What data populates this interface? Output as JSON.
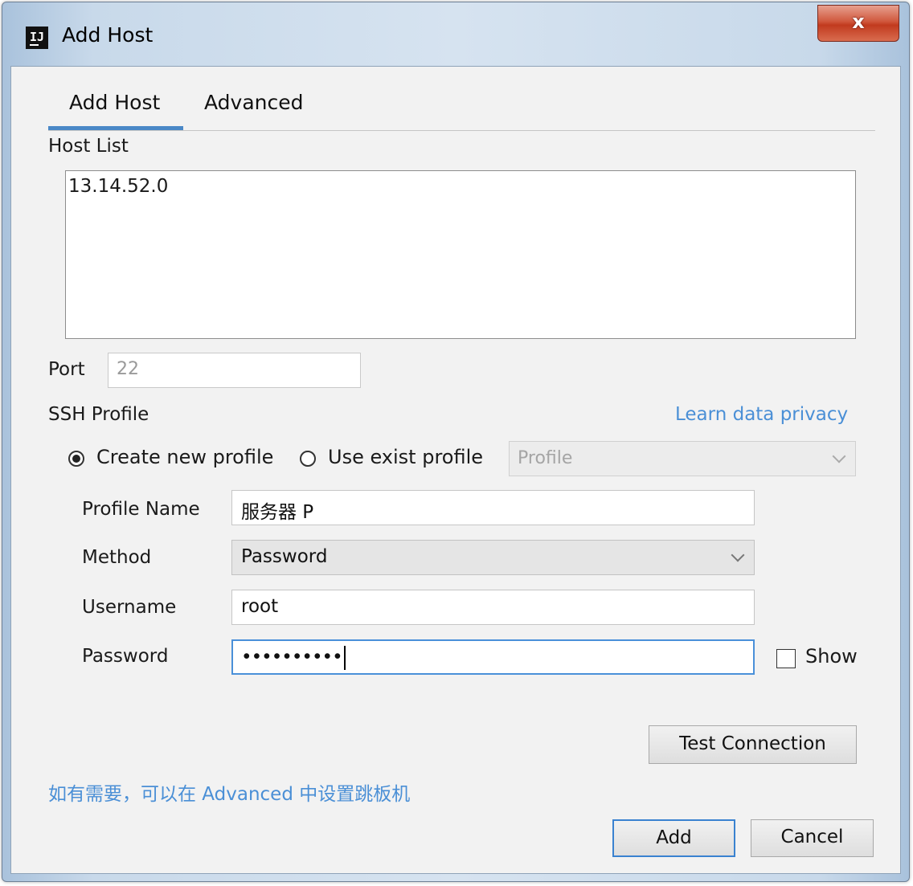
{
  "window": {
    "title": "Add Host",
    "app_icon_text": "IJ",
    "close_symbol": "x"
  },
  "tabs": [
    {
      "label": "Add Host",
      "active": true
    },
    {
      "label": "Advanced",
      "active": false
    }
  ],
  "host_list": {
    "label": "Host List",
    "value": "13.14.52.0"
  },
  "port": {
    "label": "Port",
    "value": "22"
  },
  "ssh_profile": {
    "label": "SSH Profile",
    "privacy_link": "Learn data privacy",
    "options": {
      "create_new": "Create new profile",
      "use_exist": "Use exist profile",
      "selected": "create_new"
    },
    "profile_select": {
      "value": "Profile",
      "disabled": true
    }
  },
  "form": {
    "profile_name": {
      "label": "Profile Name",
      "value": "服务器 P"
    },
    "method": {
      "label": "Method",
      "value": "Password"
    },
    "username": {
      "label": "Username",
      "value": "root"
    },
    "password": {
      "label": "Password",
      "value": "••••••••••"
    },
    "show_label": "Show",
    "show_checked": false
  },
  "buttons": {
    "test_connection": "Test Connection",
    "add": "Add",
    "cancel": "Cancel"
  },
  "hint": "如有需要，可以在 Advanced 中设置跳板机",
  "colors": {
    "accent": "#4a88c7",
    "link": "#4a8fd6",
    "close_button": "#c13a1e"
  }
}
